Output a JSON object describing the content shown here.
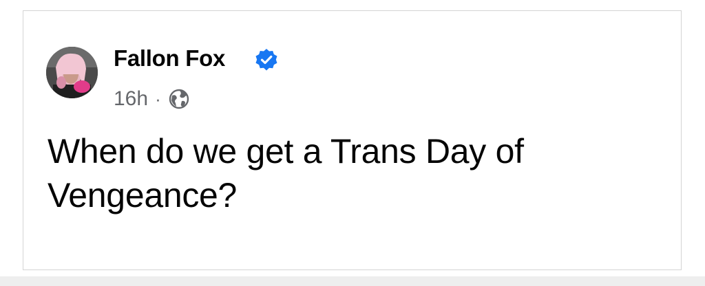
{
  "post": {
    "author": {
      "name": "Fallon Fox",
      "avatar_icon": "profile-photo",
      "verified_icon": "verified-badge-icon",
      "verified_color": "#1877f2"
    },
    "meta": {
      "timestamp": "16h",
      "separator": "·",
      "audience_icon": "globe-icon"
    },
    "text": "When do we get a Trans Day of Vengeance?"
  },
  "colors": {
    "name": "#050505",
    "meta": "#65676b",
    "card_border": "#d4d4d4",
    "background": "#ffffff"
  }
}
